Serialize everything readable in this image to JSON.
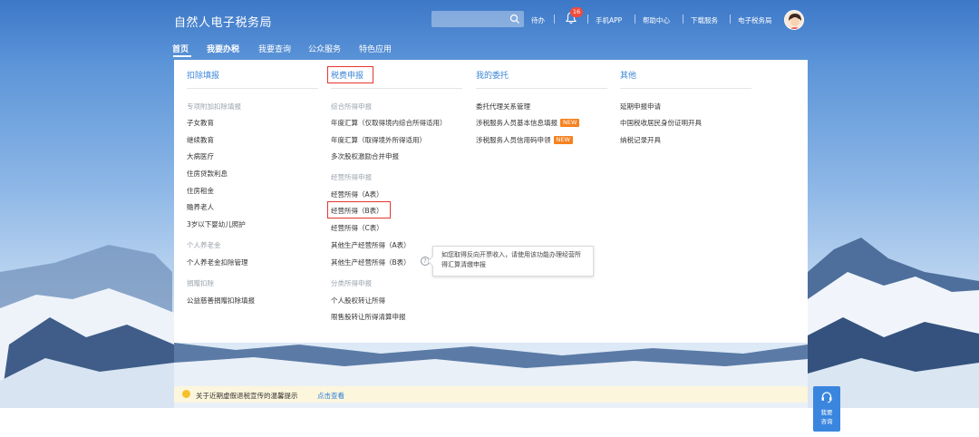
{
  "header": {
    "site_title": "自然人电子税务局",
    "links": {
      "todo": "待办",
      "mobile_app": "手机APP",
      "help_center": "帮助中心",
      "download": "下载服务",
      "etax": "电子税务局"
    },
    "notification_count": "16"
  },
  "nav": {
    "items": [
      "首页",
      "我要办税",
      "我要查询",
      "公众服务",
      "特色应用"
    ]
  },
  "menu": {
    "deduction": {
      "title": "扣除填报",
      "special_label": "专项附加扣除填报",
      "special_items": [
        "子女教育",
        "继续教育",
        "大病医疗",
        "住房贷款利息",
        "住房租金",
        "赡养老人",
        "3岁以下婴幼儿照护"
      ],
      "pension_label": "个人养老金",
      "pension_items": [
        "个人养老金扣除管理"
      ],
      "donation_label": "捐赠扣除",
      "donation_items": [
        "公益慈善捐赠扣除填报"
      ]
    },
    "tax_filing": {
      "title": "税费申报",
      "comprehensive_label": "综合所得申报",
      "comprehensive_items": [
        "年度汇算（仅取得境内综合所得适用）",
        "年度汇算（取得境外所得适用）",
        "多次股权激励合并申报"
      ],
      "business_label": "经营所得申报",
      "business_items": [
        "经营所得（A表）",
        "经营所得（B表）",
        "经营所得（C表）",
        "其他生产经营所得（A表）",
        "其他生产经营所得（B表）"
      ],
      "classified_label": "分类所得申报",
      "classified_items": [
        "个人股权转让所得",
        "限售股转让所得清算申报"
      ]
    },
    "delegation": {
      "title": "我的委托",
      "items": [
        "委托代理关系管理",
        "涉税服务人员基本信息填报",
        "涉税服务人员信用码申领"
      ],
      "new_badge": "NEW"
    },
    "other": {
      "title": "其他",
      "items": [
        "延期申报申请",
        "中国税收居民身份证明开具",
        "纳税记录开具"
      ]
    }
  },
  "tooltip": {
    "text": "如您取得反向开票收入，请使用该功能办理经营所得汇算清缴申报"
  },
  "notice": {
    "text": "关于近期虚假退税宣传的温馨提示",
    "link": "点击查看"
  },
  "float_button": {
    "line1": "我要",
    "line2": "咨询"
  },
  "colors": {
    "brand_blue": "#3e86d9",
    "highlight_red": "#e3362e",
    "new_badge": "#f58220",
    "notification_red": "#f24b3b"
  }
}
